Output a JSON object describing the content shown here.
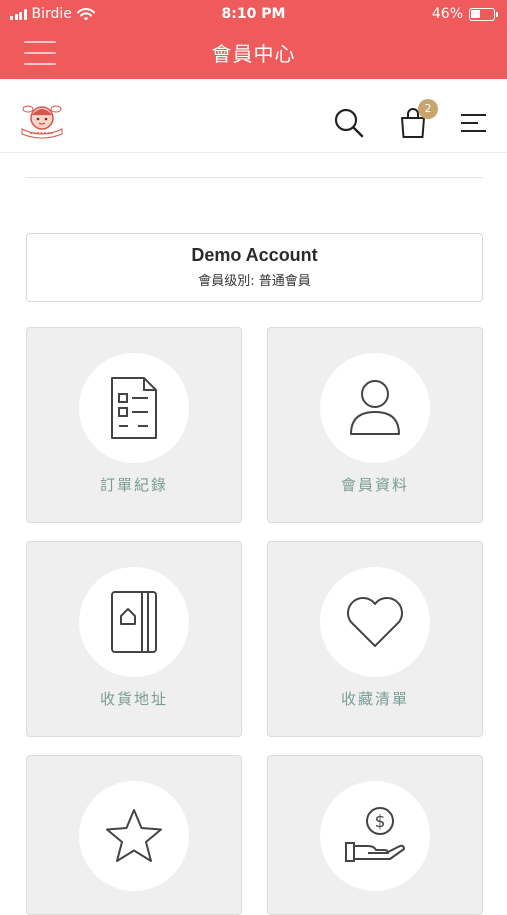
{
  "status_bar": {
    "carrier": "Birdie",
    "time": "8:10 PM",
    "battery_percent": "46%",
    "battery_level": 0.46
  },
  "title_bar": {
    "title": "會員中心",
    "background_color": "#ef5b5b"
  },
  "header": {
    "logo_icon": "angel-kids-logo",
    "cart_count": "2",
    "badge_color": "#c9a46c"
  },
  "account": {
    "name": "Demo Account",
    "level": "會員级別: 普通會員"
  },
  "tiles": [
    {
      "label": "訂單紀錄",
      "icon": "order-list-icon"
    },
    {
      "label": "會員資料",
      "icon": "user-icon"
    },
    {
      "label": "收貨地址",
      "icon": "address-book-icon"
    },
    {
      "label": "收藏清單",
      "icon": "heart-icon"
    },
    {
      "label": "",
      "icon": "star-icon"
    },
    {
      "label": "",
      "icon": "money-hand-icon"
    }
  ],
  "colors": {
    "label_color": "#7a9c95",
    "tile_background": "#efefef"
  }
}
